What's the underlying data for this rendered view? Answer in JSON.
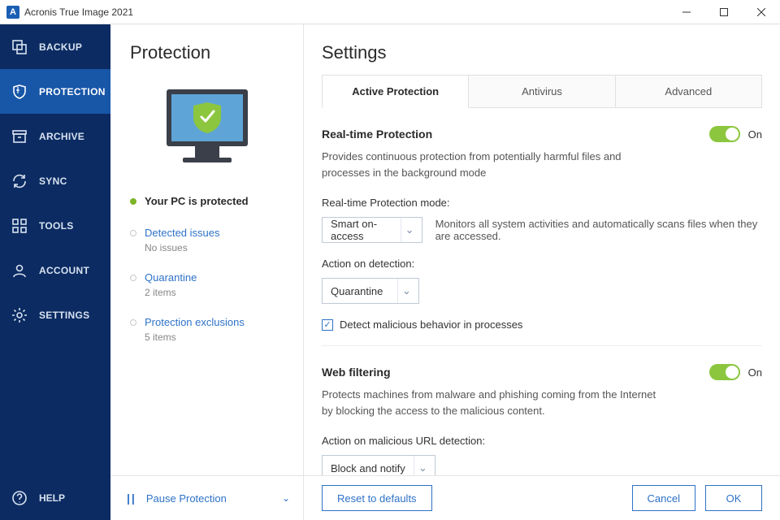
{
  "app": {
    "title": "Acronis True Image 2021"
  },
  "colors": {
    "sidebar": "#0c2b62",
    "accent": "#2e72c7",
    "toggle_on": "#8cc63f",
    "status_ok": "#7db52a"
  },
  "sidebar": {
    "items": [
      {
        "label": "BACKUP",
        "icon": "copy-icon"
      },
      {
        "label": "PROTECTION",
        "icon": "shield-icon",
        "selected": true
      },
      {
        "label": "ARCHIVE",
        "icon": "archive-icon"
      },
      {
        "label": "SYNC",
        "icon": "sync-icon"
      },
      {
        "label": "TOOLS",
        "icon": "grid-icon"
      },
      {
        "label": "ACCOUNT",
        "icon": "user-icon"
      },
      {
        "label": "SETTINGS",
        "icon": "gear-icon"
      }
    ],
    "help_label": "HELP"
  },
  "mid": {
    "heading": "Protection",
    "status": {
      "text": "Your PC is protected",
      "dot_color": "#7db52a"
    },
    "links": [
      {
        "title": "Detected issues",
        "sub": "No issues"
      },
      {
        "title": "Quarantine",
        "sub": "2 items"
      },
      {
        "title": "Protection exclusions",
        "sub": "5 items"
      }
    ],
    "pause_label": "Pause Protection"
  },
  "settings": {
    "heading": "Settings",
    "tabs": [
      {
        "label": "Active Protection",
        "active": true
      },
      {
        "label": "Antivirus"
      },
      {
        "label": "Advanced"
      }
    ],
    "rtp": {
      "title": "Real-time Protection",
      "desc": "Provides continuous protection from potentially harmful files and processes in the background mode",
      "toggle_state": "On",
      "mode_label": "Real-time Protection mode:",
      "mode_value": "Smart on-access",
      "mode_hint": "Monitors all system activities and automatically scans files when they are accessed.",
      "action_label": "Action on detection:",
      "action_value": "Quarantine",
      "behavior_checkbox": "Detect malicious behavior in processes",
      "behavior_checked": true
    },
    "web": {
      "title": "Web filtering",
      "desc": "Protects machines from malware and phishing coming from the Internet by blocking the access to the malicious content.",
      "toggle_state": "On",
      "action_label": "Action on malicious URL detection:",
      "action_value": "Block and notify"
    },
    "footer": {
      "reset": "Reset to defaults",
      "cancel": "Cancel",
      "ok": "OK"
    }
  }
}
